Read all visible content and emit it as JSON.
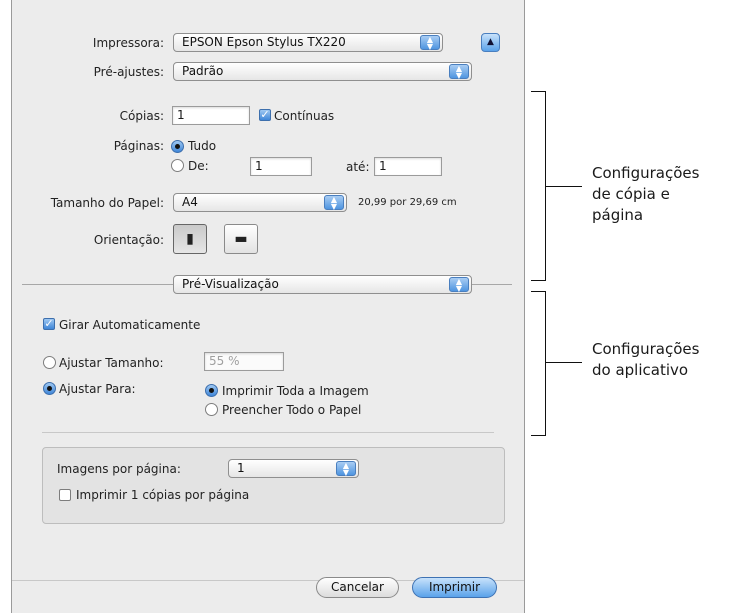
{
  "printer": {
    "label": "Impressora:",
    "value": "EPSON Epson Stylus TX220"
  },
  "presets": {
    "label": "Pré-ajustes:",
    "value": "Padrão"
  },
  "copies": {
    "label": "Cópias:",
    "value": "1",
    "collated_label": "Contínuas",
    "collated_checked": true
  },
  "pages": {
    "label": "Páginas:",
    "all_label": "Tudo",
    "all_selected": true,
    "from_label": "De:",
    "from_value": "1",
    "to_label": "até:",
    "to_value": "1"
  },
  "paper_size": {
    "label": "Tamanho do Papel:",
    "value": "A4",
    "dimensions": "20,99 por 29,69 cm"
  },
  "orientation": {
    "label": "Orientação:"
  },
  "section_popup": {
    "value": "Pré-Visualização"
  },
  "auto_rotate": {
    "label": "Girar Automaticamente",
    "checked": true
  },
  "scale": {
    "label": "Ajustar Tamanho:",
    "value": "55 %",
    "selected": false
  },
  "fit": {
    "label": "Ajustar Para:",
    "selected": true,
    "option_print_entire": "Imprimir Toda a Imagem",
    "option_fill_paper": "Preencher Todo o Papel",
    "print_entire_selected": true
  },
  "images_per_page": {
    "label": "Imagens por página:",
    "value": "1",
    "copies_per_page_label": "Imprimir 1 cópias por página",
    "copies_per_page_checked": false
  },
  "buttons": {
    "cancel": "Cancelar",
    "print": "Imprimir"
  },
  "callouts": {
    "copy_page": [
      "Configurações",
      "de cópia e",
      "página"
    ],
    "application": [
      "Configurações",
      "do aplicativo"
    ]
  },
  "colors": {
    "dialog_bg": "#ececec",
    "accent_blue": "#5aa2ea"
  }
}
